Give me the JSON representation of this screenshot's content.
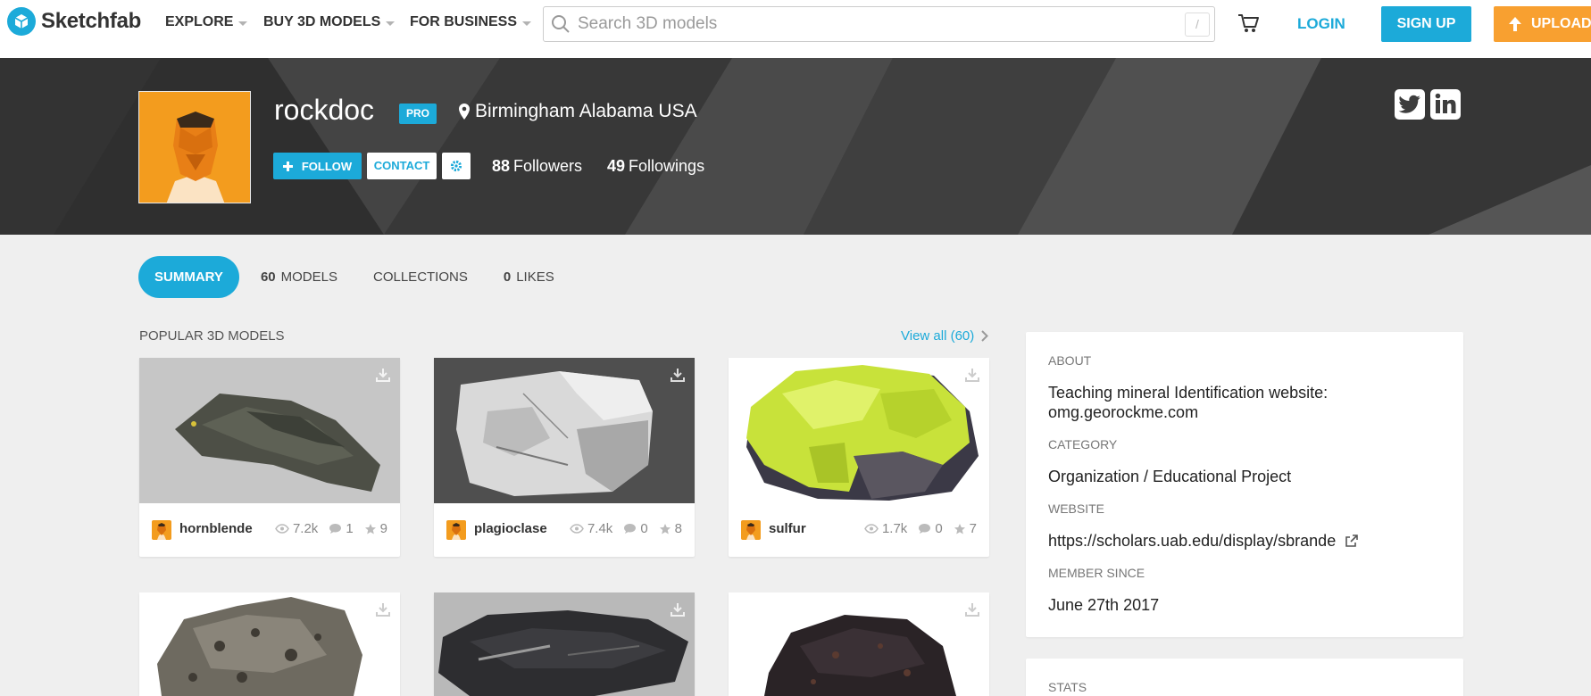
{
  "header": {
    "logo_text": "Sketchfab",
    "nav": [
      {
        "label": "EXPLORE"
      },
      {
        "label": "BUY 3D MODELS"
      },
      {
        "label": "FOR BUSINESS"
      }
    ],
    "search_placeholder": "Search 3D models",
    "search_shortcut": "/",
    "login_label": "LOGIN",
    "signup_label": "SIGN UP",
    "upload_label": "UPLOAD"
  },
  "profile": {
    "username": "rockdoc",
    "badge": "PRO",
    "location": "Birmingham Alabama USA",
    "follow_label": "FOLLOW",
    "contact_label": "CONTACT",
    "followers_count": "88",
    "followers_label": "Followers",
    "followings_count": "49",
    "followings_label": "Followings"
  },
  "tabs": {
    "summary": "SUMMARY",
    "models_count": "60",
    "models_label": "MODELS",
    "collections": "COLLECTIONS",
    "likes_count": "0",
    "likes_label": "LIKES"
  },
  "popular": {
    "title": "POPULAR 3D MODELS",
    "view_all": "View all (60)",
    "models": [
      {
        "name": "hornblende",
        "views": "7.2k",
        "comments": "1",
        "likes": "9"
      },
      {
        "name": "plagioclase",
        "views": "7.4k",
        "comments": "0",
        "likes": "8"
      },
      {
        "name": "sulfur",
        "views": "1.7k",
        "comments": "0",
        "likes": "7"
      }
    ]
  },
  "about": {
    "about_label": "ABOUT",
    "about_text": "Teaching mineral Identification website: omg.georockme.com",
    "category_label": "CATEGORY",
    "category_value": "Organization / Educational Project",
    "website_label": "WEBSITE",
    "website_value": "https://scholars.uab.edu/display/sbrande",
    "member_label": "MEMBER SINCE",
    "member_value": "June 27th 2017"
  },
  "stats_label": "STATS",
  "colors": {
    "accent": "#1caad9",
    "upload": "#f8a030",
    "banner": "#3d3d3d",
    "avatar": "#f39c1e"
  },
  "icons": [
    "sketchfab-logo-icon",
    "search-icon",
    "cart-icon",
    "upload-arrow-icon",
    "map-marker-icon",
    "plus-icon",
    "gear-icon",
    "twitter-icon",
    "linkedin-icon",
    "chevron-right-icon",
    "download-icon",
    "eye-icon",
    "comment-icon",
    "star-icon",
    "external-link-icon"
  ]
}
